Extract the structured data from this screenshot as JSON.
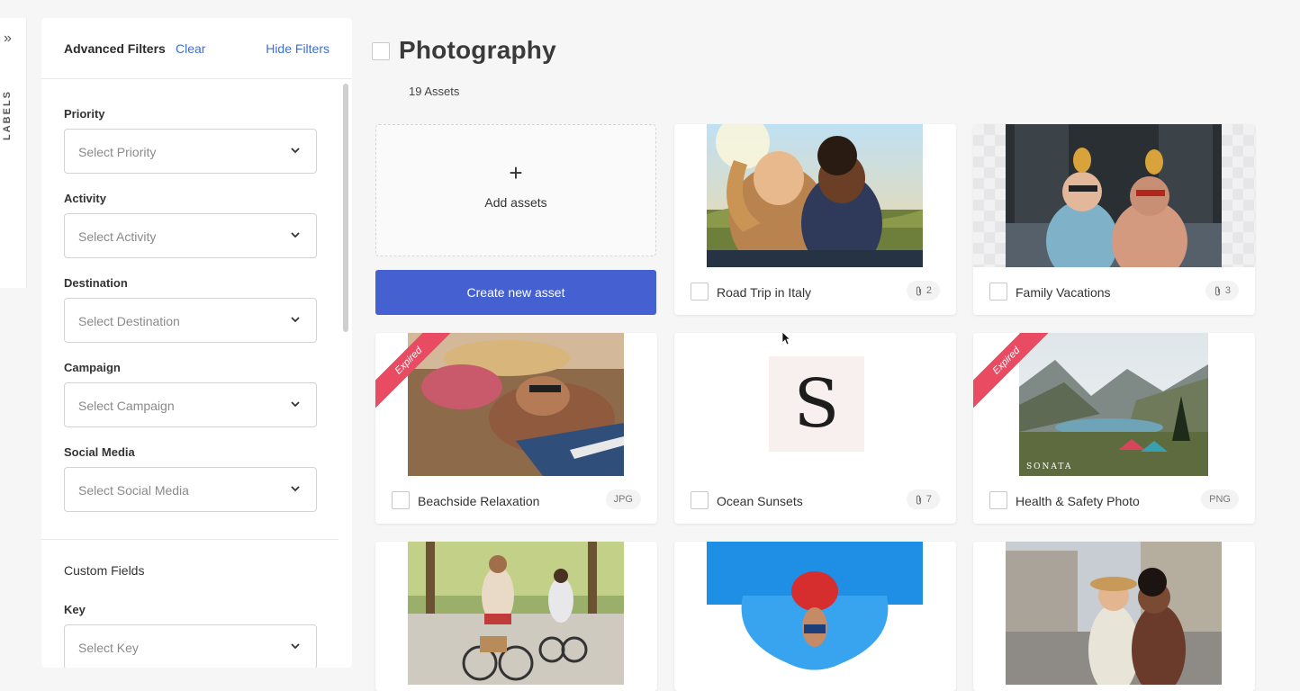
{
  "rail": {
    "expand_glyph": "»",
    "label": "LABELS"
  },
  "filters": {
    "title": "Advanced Filters",
    "clear": "Clear",
    "hide": "Hide Filters",
    "fields": [
      {
        "label": "Priority",
        "placeholder": "Select Priority"
      },
      {
        "label": "Activity",
        "placeholder": "Select Activity"
      },
      {
        "label": "Destination",
        "placeholder": "Select Destination"
      },
      {
        "label": "Campaign",
        "placeholder": "Select Campaign"
      },
      {
        "label": "Social Media",
        "placeholder": "Select Social Media"
      }
    ],
    "custom_fields_title": "Custom Fields",
    "key": {
      "label": "Key",
      "placeholder": "Select Key"
    }
  },
  "main": {
    "title": "Photography",
    "asset_count": "19 Assets",
    "add_assets": "Add assets",
    "create_button": "Create new asset"
  },
  "cards": [
    {
      "name": "Road Trip in Italy",
      "badge": "2",
      "badge_icon": "paperclip-icon"
    },
    {
      "name": "Family Vacations",
      "badge": "3",
      "badge_icon": "paperclip-icon"
    },
    {
      "name": "Beachside Relaxation",
      "badge": "JPG",
      "ribbon": "Expired"
    },
    {
      "name": "Ocean Sunsets",
      "badge": "7",
      "badge_icon": "paperclip-icon",
      "logo_letter": "S"
    },
    {
      "name": "Health & Safety Photo",
      "badge": "PNG",
      "ribbon": "Expired",
      "watermark": "SONATA"
    }
  ],
  "colors": {
    "accent": "#4561d1",
    "link": "#3f6fd1",
    "ribbon": "#e94b63"
  }
}
